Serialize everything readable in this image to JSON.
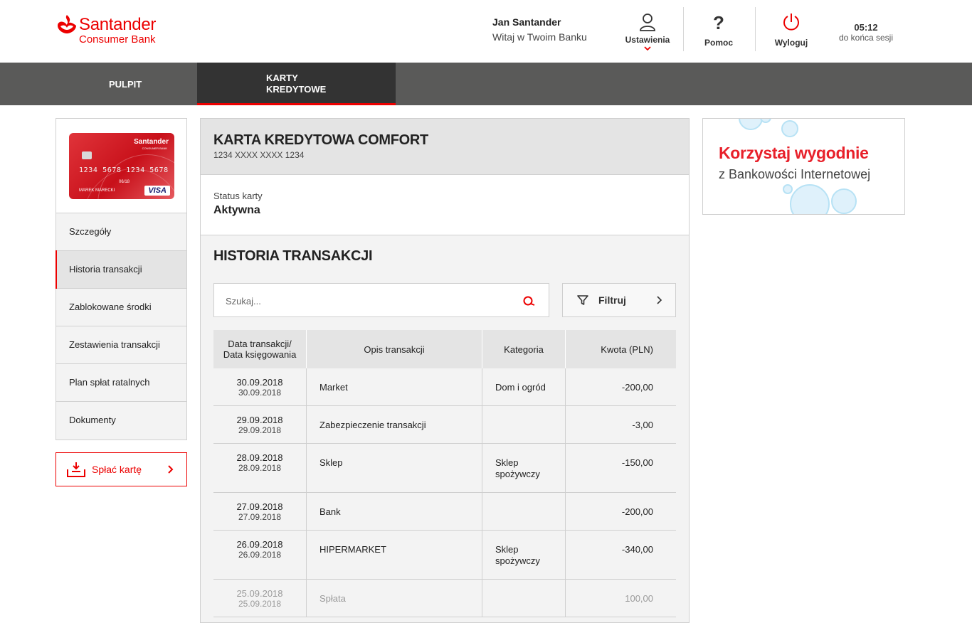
{
  "header": {
    "brand": "Santander",
    "brand_sub": "Consumer Bank",
    "user_name": "Jan Santander",
    "welcome": "Witaj w Twoim Banku",
    "settings_label": "Ustawienia",
    "help_label": "Pomoc",
    "logout_label": "Wyloguj",
    "session_time": "05:12",
    "session_text": "do końca sesji"
  },
  "nav": {
    "tabs": [
      {
        "label": "PULPIT"
      },
      {
        "label": "KARTY KREDYTOWE"
      }
    ],
    "active": "KARTY KREDYTOWE"
  },
  "card_image": {
    "brand": "Santander",
    "brand_sub": "CONSUMER BANK",
    "number": "1234 5678 1234 5678",
    "expiry": "06/18",
    "holder": "MAREK MARECKI",
    "network": "VISA"
  },
  "sidebar": {
    "items": [
      {
        "label": "Szczegóły"
      },
      {
        "label": "Historia transakcji"
      },
      {
        "label": "Zablokowane środki"
      },
      {
        "label": "Zestawienia transakcji"
      },
      {
        "label": "Plan spłat ratalnych"
      },
      {
        "label": "Dokumenty"
      }
    ],
    "active": "Historia transakcji",
    "pay_button": "Spłać kartę"
  },
  "card": {
    "title": "KARTA KREDYTOWA COMFORT",
    "number": "1234 XXXX XXXX 1234",
    "status_label": "Status karty",
    "status_value": "Aktywna"
  },
  "history": {
    "title": "HISTORIA TRANSAKCJI",
    "search_placeholder": "Szukaj...",
    "filter_label": "Filtruj",
    "columns": {
      "date_line1": "Data transakcji/",
      "date_line2": "Data księgowania",
      "desc": "Opis transakcji",
      "category": "Kategoria",
      "amount": "Kwota (PLN)"
    },
    "rows": [
      {
        "date": "30.09.2018",
        "booked": "30.09.2018",
        "desc": "Market",
        "cat1": "Dom i ogród",
        "cat2": "",
        "amount": "-200,00"
      },
      {
        "date": "29.09.2018",
        "booked": "29.09.2018",
        "desc": "Zabezpieczenie transakcji",
        "cat1": "",
        "cat2": "",
        "amount": "-3,00"
      },
      {
        "date": "28.09.2018",
        "booked": "28.09.2018",
        "desc": "Sklep",
        "cat1": "Sklep",
        "cat2": "spożywczy",
        "amount": "-150,00"
      },
      {
        "date": "27.09.2018",
        "booked": "27.09.2018",
        "desc": "Bank",
        "cat1": "",
        "cat2": "",
        "amount": "-200,00"
      },
      {
        "date": "26.09.2018",
        "booked": "26.09.2018",
        "desc": "HIPERMARKET",
        "cat1": "Sklep",
        "cat2": "spożywczy",
        "amount": "-340,00"
      },
      {
        "date": "25.09.2018",
        "booked": "25.09.2018",
        "desc": "Spłata",
        "cat1": "",
        "cat2": "",
        "amount": "100,00"
      }
    ]
  },
  "banner": {
    "headline": "Korzystaj wygodnie",
    "subline": "z Bankowości Internetowej"
  },
  "colors": {
    "brand_red": "#ec0000",
    "nav_bg": "#5a5a59",
    "nav_active_bg": "#333333",
    "panel_bg": "#f3f3f3",
    "header_row_bg": "#e4e4e4"
  },
  "icons": {
    "settings": "user-icon",
    "help": "question-icon",
    "logout": "power-icon",
    "search": "search-icon",
    "filter": "funnel-icon",
    "pay": "download-tray-icon"
  }
}
